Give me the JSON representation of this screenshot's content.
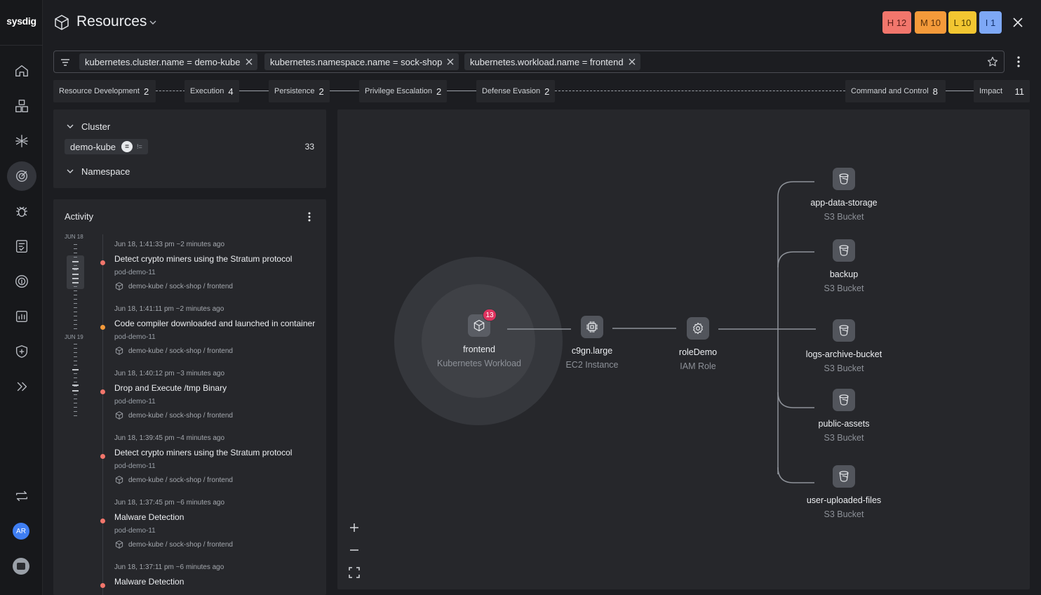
{
  "app": {
    "logo": "sysdig"
  },
  "header": {
    "title": "Resources"
  },
  "severity": [
    {
      "label": "H 12",
      "bg": "#f2766c",
      "fg": "#5a1a16"
    },
    {
      "label": "M 10",
      "bg": "#f49a3a",
      "fg": "#5a300a"
    },
    {
      "label": "L 10",
      "bg": "#f2c631",
      "fg": "#4d3b00"
    },
    {
      "label": "I 1",
      "bg": "#7ea8f6",
      "fg": "#12306b"
    }
  ],
  "filters": [
    {
      "label": "kubernetes.cluster.name = demo-kube"
    },
    {
      "label": "kubernetes.namespace.name = sock-shop"
    },
    {
      "label": "kubernetes.workload.name = frontend"
    }
  ],
  "tactics": [
    {
      "name": "Resource Development",
      "count": "2"
    },
    {
      "name": "Execution",
      "count": "4"
    },
    {
      "name": "Persistence",
      "count": "2"
    },
    {
      "name": "Privilege Escalation",
      "count": "2"
    },
    {
      "name": "Defense Evasion",
      "count": "2"
    },
    {
      "name": "Command and Control",
      "count": "8"
    },
    {
      "name": "Impact",
      "count": "11"
    }
  ],
  "cluster_panel": {
    "cluster_title": "Cluster",
    "chip": "demo-kube",
    "eq": "=",
    "neq": "!=",
    "count": "33",
    "namespace_title": "Namespace"
  },
  "activity": {
    "title": "Activity",
    "dates": [
      "JUN 18",
      "JUN 19"
    ],
    "items": [
      {
        "ts": "Jun 18, 1:41:33 pm ~2 minutes ago",
        "title": "Detect crypto miners using the Stratum protocol",
        "pod": "pod-demo-11",
        "path": "demo-kube / sock-shop / frontend",
        "color": "#f2766c"
      },
      {
        "ts": "Jun 18, 1:41:11 pm ~2 minutes ago",
        "title": "Code compiler downloaded and launched in container",
        "pod": "pod-demo-11",
        "path": "demo-kube / sock-shop / frontend",
        "color": "#f49a3a"
      },
      {
        "ts": "Jun 18, 1:40:12 pm ~3 minutes ago",
        "title": "Drop and Execute /tmp Binary",
        "pod": "pod-demo-11",
        "path": "demo-kube / sock-shop / frontend",
        "color": "#f2766c"
      },
      {
        "ts": "Jun 18, 1:39:45 pm ~4 minutes ago",
        "title": "Detect crypto miners using the Stratum protocol",
        "pod": "pod-demo-11",
        "path": "demo-kube / sock-shop / frontend",
        "color": "#f2766c"
      },
      {
        "ts": "Jun 18, 1:37:45 pm ~6 minutes ago",
        "title": "Malware Detection",
        "pod": "pod-demo-11",
        "path": "demo-kube / sock-shop / frontend",
        "color": "#f2766c"
      },
      {
        "ts": "Jun 18, 1:37:11 pm ~6 minutes ago",
        "title": "Malware Detection",
        "pod": "",
        "path": "",
        "color": "#f2766c"
      }
    ]
  },
  "graph": {
    "frontend": {
      "name": "frontend",
      "type": "Kubernetes Workload",
      "badge": "13"
    },
    "ec2": {
      "name": "c9gn.large",
      "type": "EC2 Instance"
    },
    "role": {
      "name": "roleDemo",
      "type": "IAM Role"
    },
    "buckets": [
      {
        "name": "app-data-storage",
        "type": "S3 Bucket"
      },
      {
        "name": "backup",
        "type": "S3 Bucket"
      },
      {
        "name": "logs-archive-bucket",
        "type": "S3 Bucket"
      },
      {
        "name": "public-assets",
        "type": "S3 Bucket"
      },
      {
        "name": "user-uploaded-files",
        "type": "S3 Bucket"
      }
    ]
  },
  "user": {
    "initials": "AR"
  }
}
